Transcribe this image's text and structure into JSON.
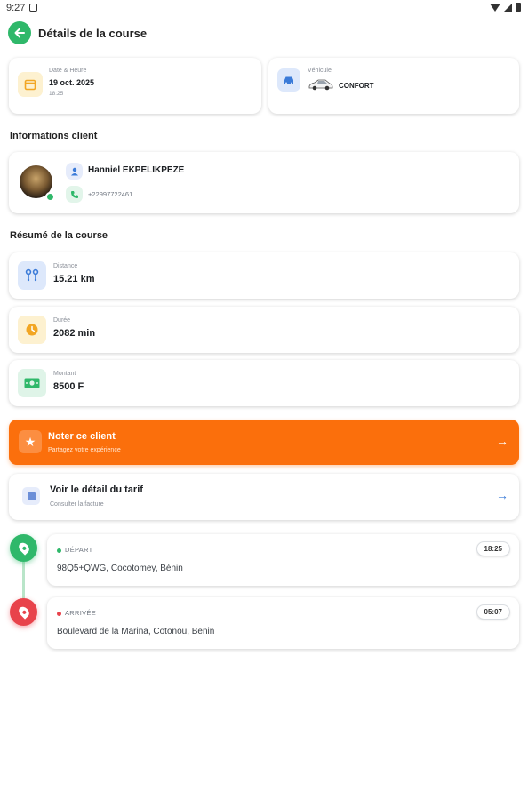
{
  "status_bar": {
    "time": "9:27"
  },
  "header": {
    "title": "Détails de la course"
  },
  "date_card": {
    "label": "Date & Heure",
    "date": "19 oct. 2025",
    "time": "18:25"
  },
  "vehicle_card": {
    "label": "Véhicule",
    "category": "CONFORT"
  },
  "client_section": {
    "title": "Informations client",
    "name": "Hanniel EKPELIKPEZE",
    "phone": "+22997722461"
  },
  "summary_section": {
    "title": "Résumé de la course",
    "distance": {
      "label": "Distance",
      "value": "15.21 km"
    },
    "duration": {
      "label": "Durée",
      "value": "2082 min"
    },
    "amount": {
      "label": "Montant",
      "value": "8500 F"
    }
  },
  "rate_card": {
    "title": "Noter ce client",
    "subtitle": "Partagez votre expérience"
  },
  "tarif_card": {
    "title": "Voir le détail du tarif",
    "subtitle": "Consulter la facture"
  },
  "trip": {
    "departure": {
      "tag": "DÉPART",
      "time": "18:25",
      "address": "98Q5+QWG, Cocotomey, Bénin"
    },
    "arrival": {
      "tag": "ARRIVÉE",
      "time": "05:07",
      "address": "Boulevard de la Marina, Cotonou, Benin"
    }
  },
  "colors": {
    "accent_green": "#2fb86a",
    "accent_orange": "#fb6f0c",
    "arrival_red": "#e8434b",
    "link_blue": "#3b7bd8"
  }
}
